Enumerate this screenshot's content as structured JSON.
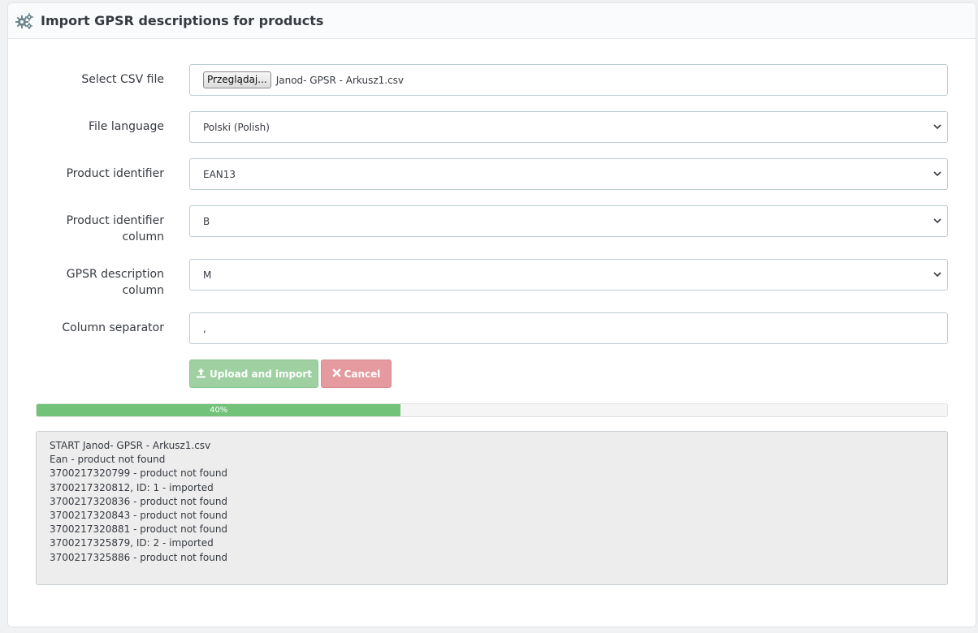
{
  "header": {
    "title": "Import GPSR descriptions for products",
    "icon": "gears-icon"
  },
  "form": {
    "csv_file": {
      "label": "Select CSV file",
      "browse_label": "Przeglądaj...",
      "file_name": "Janod- GPSR - Arkusz1.csv"
    },
    "file_language": {
      "label": "File language",
      "value": "Polski (Polish)"
    },
    "product_identifier": {
      "label": "Product identifier",
      "value": "EAN13"
    },
    "identifier_column": {
      "label_line1": "Product identifier",
      "label_line2": "column",
      "value": "B"
    },
    "description_column": {
      "label_line1": "GPSR description",
      "label_line2": "column",
      "value": "M"
    },
    "separator": {
      "label": "Column separator",
      "value": ","
    }
  },
  "buttons": {
    "upload_label": "Upload and import",
    "cancel_label": "Cancel",
    "upload_color": "#9ed0a1",
    "cancel_color": "#e49a9e"
  },
  "progress": {
    "value": 0.4,
    "label": "40%",
    "color": "#72c279"
  },
  "log": {
    "lines": [
      "START Janod- GPSR - Arkusz1.csv",
      "Ean - product not found",
      "3700217320799 - product not found",
      "3700217320812, ID: 1 - imported",
      "3700217320836 - product not found",
      "3700217320843 - product not found",
      "3700217320881 - product not found",
      "3700217325879, ID: 2 - imported",
      "3700217325886 - product not found"
    ]
  }
}
